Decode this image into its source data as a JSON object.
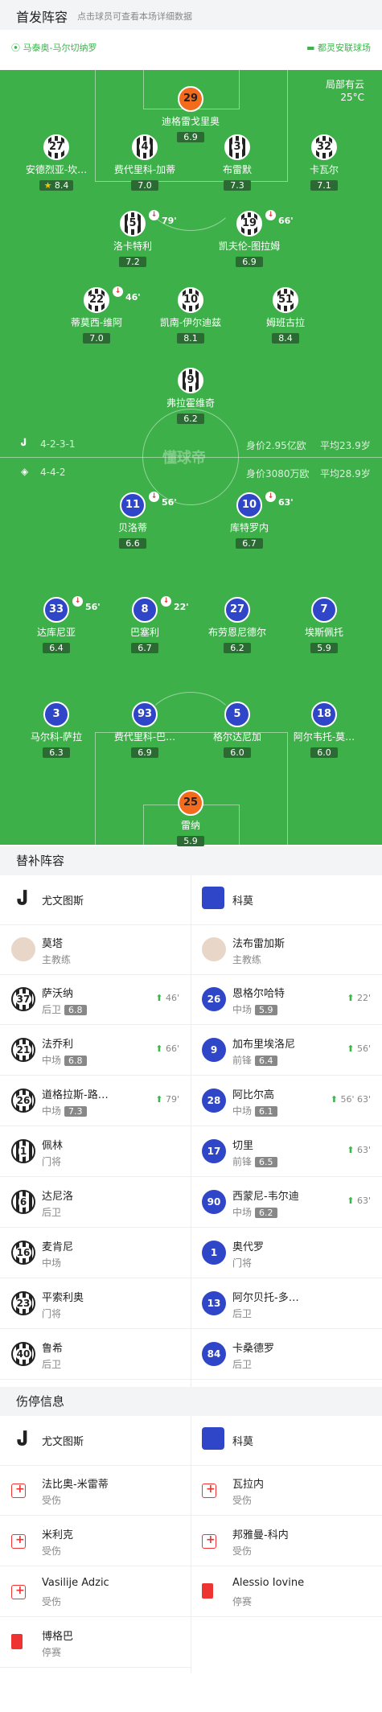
{
  "header": {
    "title": "首发阵容",
    "subtitle": "点击球员可查看本场详细数据"
  },
  "venue": {
    "referee": "马泰奥-马尔切纳罗",
    "stadium": "都灵安联球场"
  },
  "weather": {
    "desc": "局部有云",
    "temp": "25°C"
  },
  "home": {
    "formation": "4-2-3-1",
    "value": "身价2.95亿欧",
    "age": "平均23.9岁",
    "players": [
      {
        "num": "29",
        "name": "迪格雷戈里奥",
        "rating": "6.9",
        "style": "co"
      },
      {
        "num": "27",
        "name": "安德烈亚-坎…",
        "rating": "8.4",
        "style": "cw",
        "star": true
      },
      {
        "num": "4",
        "name": "费代里科-加蒂",
        "rating": "7.0",
        "style": "cw"
      },
      {
        "num": "3",
        "name": "布雷默",
        "rating": "7.3",
        "style": "cw"
      },
      {
        "num": "32",
        "name": "卡瓦尔",
        "rating": "7.1",
        "style": "cw"
      },
      {
        "num": "5",
        "name": "洛卡特利",
        "rating": "7.2",
        "style": "cw",
        "sub": "79'"
      },
      {
        "num": "19",
        "name": "凯夫伦-图拉姆",
        "rating": "6.9",
        "style": "cw",
        "sub": "66'"
      },
      {
        "num": "22",
        "name": "蒂莫西-维阿",
        "rating": "7.0",
        "style": "cw",
        "sub": "46'"
      },
      {
        "num": "10",
        "name": "凯南-伊尔迪兹",
        "rating": "8.1",
        "style": "cw"
      },
      {
        "num": "51",
        "name": "姆班古拉",
        "rating": "8.4",
        "style": "cw"
      },
      {
        "num": "9",
        "name": "弗拉霍维奇",
        "rating": "6.2",
        "style": "cw"
      }
    ]
  },
  "away": {
    "formation": "4-4-2",
    "value": "身价3080万欧",
    "age": "平均28.9岁",
    "players": [
      {
        "num": "11",
        "name": "贝洛蒂",
        "rating": "6.6",
        "sub": "56'"
      },
      {
        "num": "10",
        "name": "库特罗内",
        "rating": "6.7",
        "sub": "63'"
      },
      {
        "num": "33",
        "name": "达库尼亚",
        "rating": "6.4",
        "sub": "56'"
      },
      {
        "num": "8",
        "name": "巴塞利",
        "rating": "6.7",
        "sub": "22'"
      },
      {
        "num": "27",
        "name": "布劳恩尼德尔",
        "rating": "6.2"
      },
      {
        "num": "7",
        "name": "埃斯佩托",
        "rating": "5.9"
      },
      {
        "num": "3",
        "name": "马尔科-萨拉",
        "rating": "6.3"
      },
      {
        "num": "93",
        "name": "费代里科-巴…",
        "rating": "6.9"
      },
      {
        "num": "5",
        "name": "格尔达尼加",
        "rating": "6.0"
      },
      {
        "num": "18",
        "name": "阿尔韦托-莫…",
        "rating": "6.0"
      },
      {
        "num": "25",
        "name": "雷纳",
        "rating": "5.9",
        "style": "co"
      }
    ]
  },
  "watermark": "懂球帝",
  "subs": {
    "title": "替补阵容",
    "home_team": "尤文图斯",
    "away_team": "科莫",
    "home_coach": {
      "name": "莫塔",
      "role": "主教练"
    },
    "away_coach": {
      "name": "法布雷加斯",
      "role": "主教练"
    },
    "home": [
      {
        "num": "37",
        "name": "萨沃纳",
        "pos": "后卫",
        "score": "6.8",
        "ev": "46'"
      },
      {
        "num": "21",
        "name": "法乔利",
        "pos": "中场",
        "score": "6.8",
        "ev": "66'"
      },
      {
        "num": "26",
        "name": "道格拉斯-路…",
        "pos": "中场",
        "score": "7.3",
        "ev": "79'"
      },
      {
        "num": "1",
        "name": "佩林",
        "pos": "门将"
      },
      {
        "num": "6",
        "name": "达尼洛",
        "pos": "后卫"
      },
      {
        "num": "16",
        "name": "麦肯尼",
        "pos": "中场"
      },
      {
        "num": "23",
        "name": "平索利奥",
        "pos": "门将"
      },
      {
        "num": "40",
        "name": "鲁希",
        "pos": "后卫"
      }
    ],
    "away": [
      {
        "num": "26",
        "name": "恩格尔哈特",
        "pos": "中场",
        "score": "5.9",
        "ev": "22'"
      },
      {
        "num": "9",
        "name": "加布里埃洛尼",
        "pos": "前锋",
        "score": "6.4",
        "ev": "56'"
      },
      {
        "num": "28",
        "name": "阿比尔高",
        "pos": "中场",
        "score": "6.1",
        "ev": "56' 63'"
      },
      {
        "num": "17",
        "name": "切里",
        "pos": "前锋",
        "score": "6.5",
        "ev": "63'"
      },
      {
        "num": "90",
        "name": "西蒙尼-韦尔迪",
        "pos": "中场",
        "score": "6.2",
        "ev": "63'"
      },
      {
        "num": "1",
        "name": "奥代罗",
        "pos": "门将"
      },
      {
        "num": "13",
        "name": "阿尔贝托-多…",
        "pos": "后卫"
      },
      {
        "num": "84",
        "name": "卡桑德罗",
        "pos": "后卫"
      }
    ]
  },
  "injuries": {
    "title": "伤停信息",
    "home_team": "尤文图斯",
    "away_team": "科莫",
    "home": [
      {
        "name": "法比奥-米雷蒂",
        "status": "受伤",
        "type": "inj"
      },
      {
        "name": "米利克",
        "status": "受伤",
        "type": "inj"
      },
      {
        "name": "Vasilije Adzic",
        "status": "受伤",
        "type": "inj"
      },
      {
        "name": "博格巴",
        "status": "停赛",
        "type": "red"
      }
    ],
    "away": [
      {
        "name": "瓦拉内",
        "status": "受伤",
        "type": "inj"
      },
      {
        "name": "邦雅曼-科内",
        "status": "受伤",
        "type": "inj"
      },
      {
        "name": "Alessio Iovine",
        "status": "停赛",
        "type": "red"
      }
    ]
  }
}
